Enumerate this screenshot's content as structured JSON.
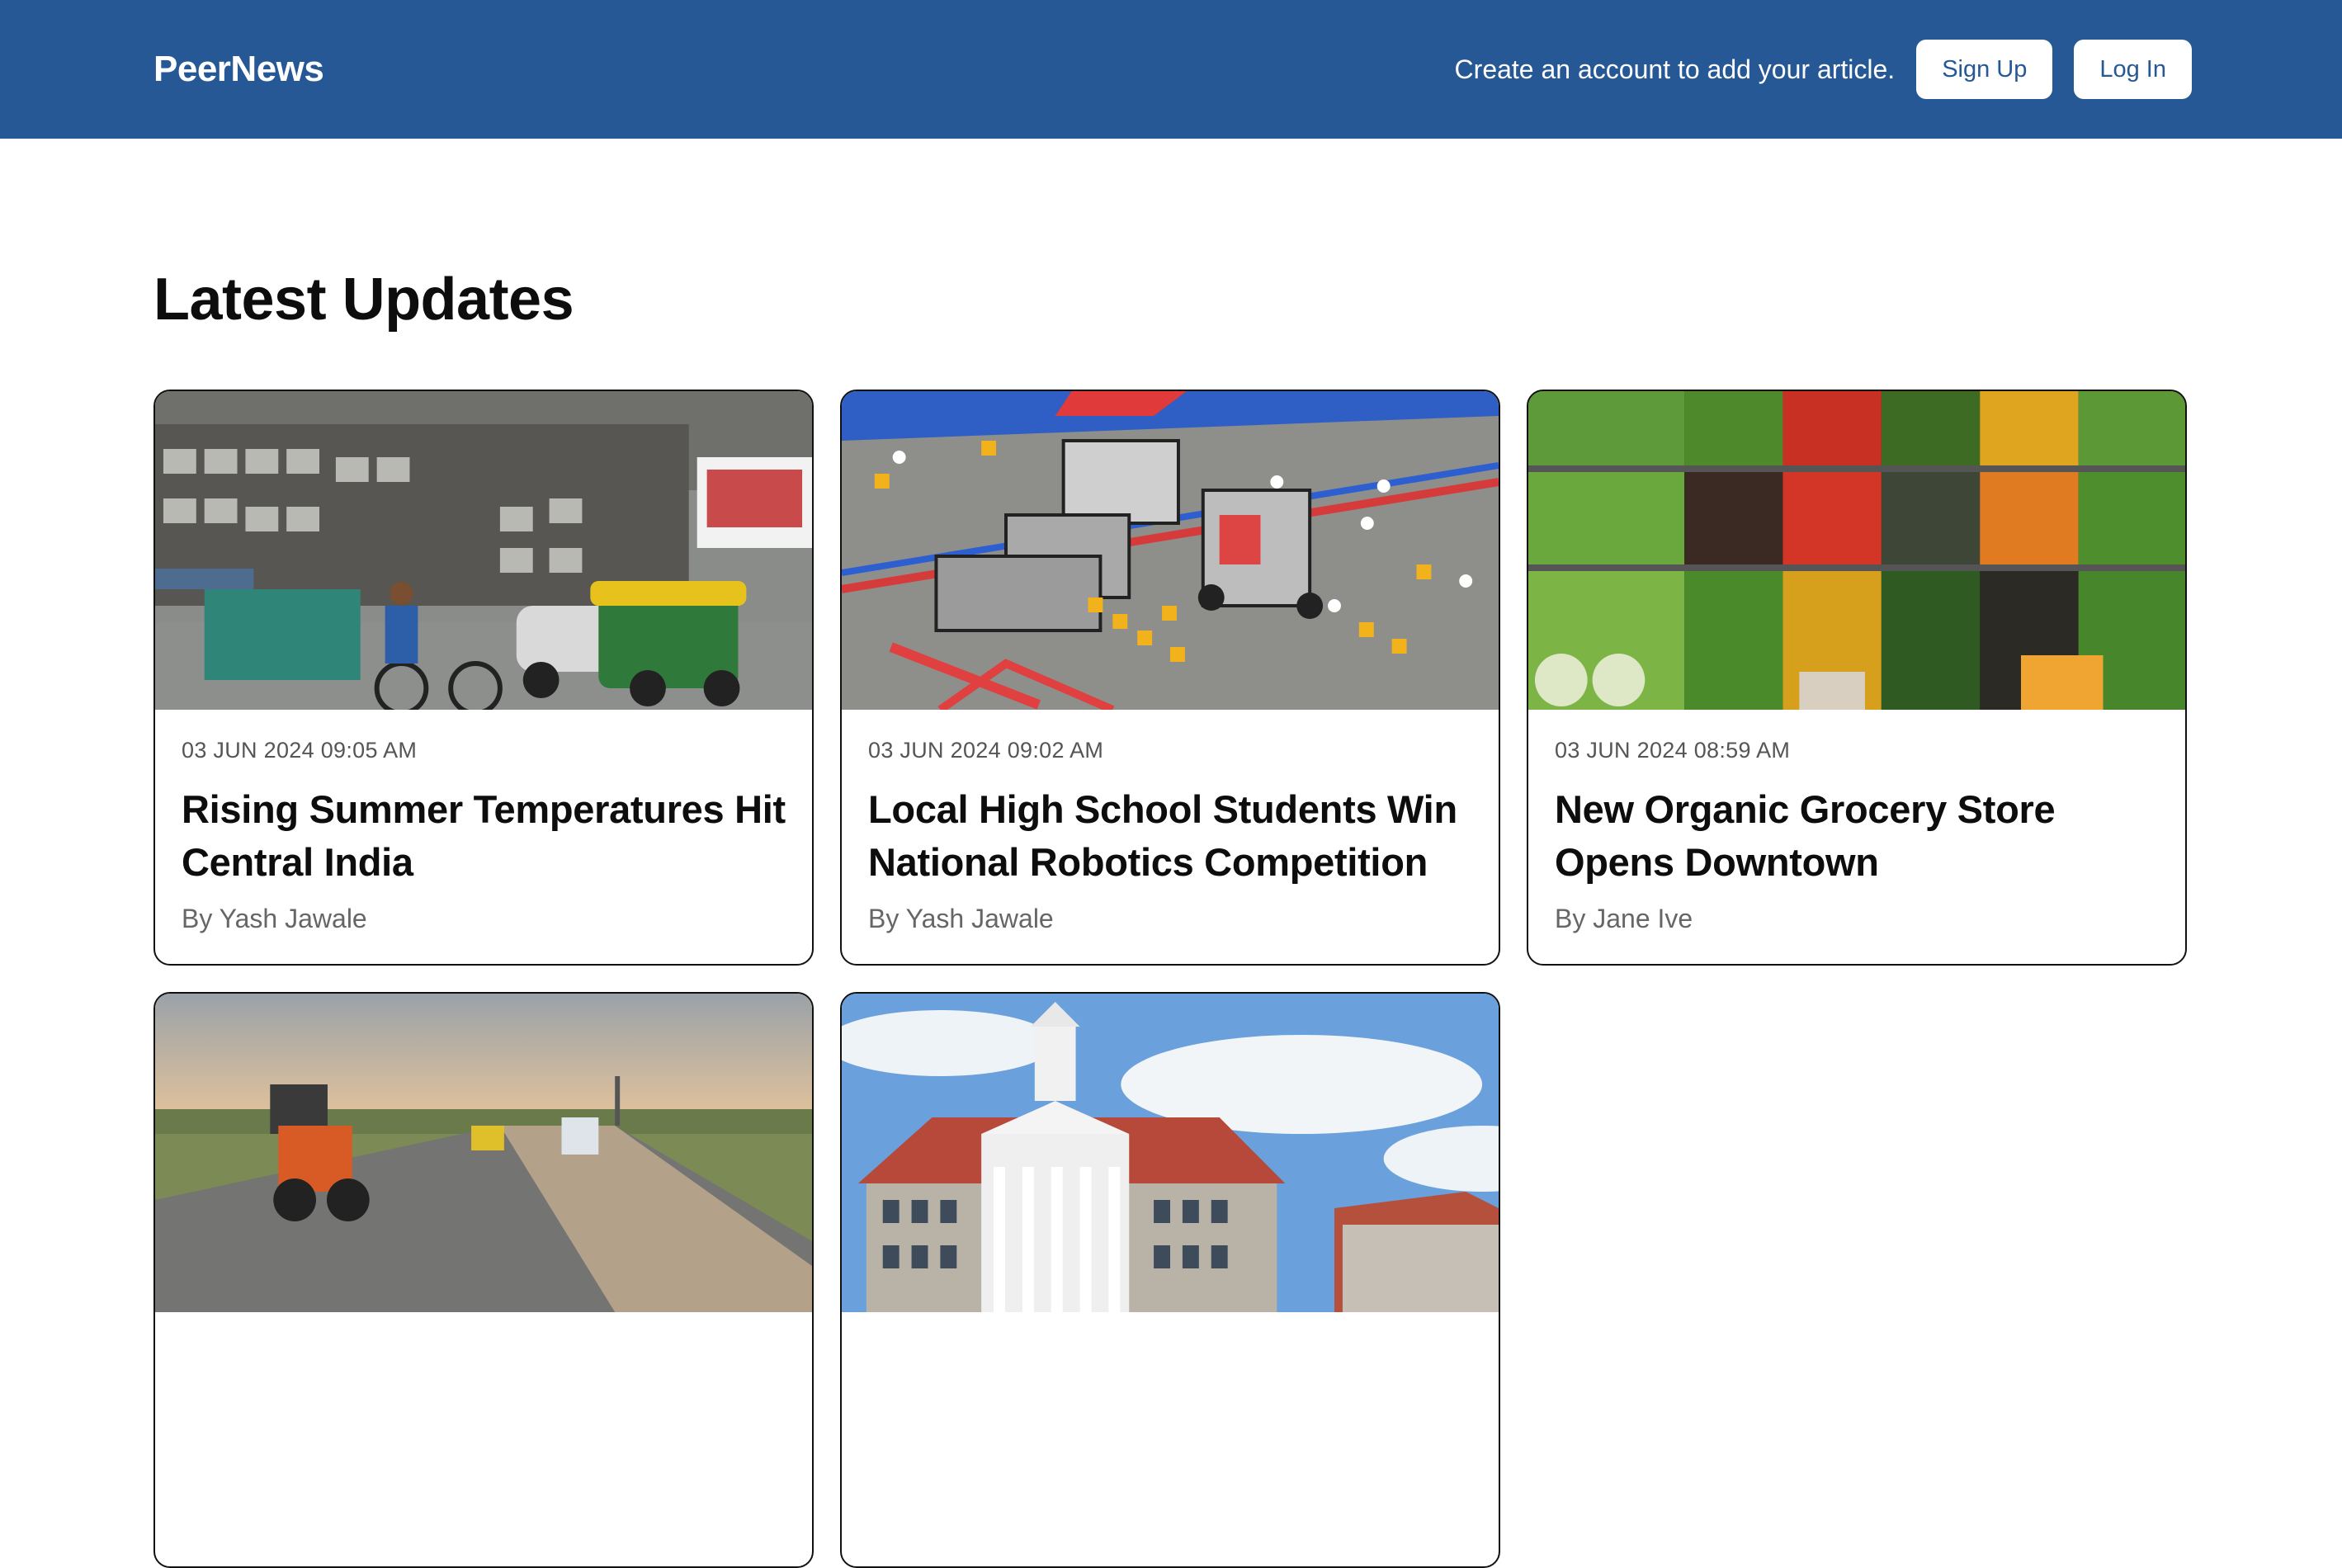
{
  "header": {
    "brand": "PeerNews",
    "prompt": "Create an account to add your article.",
    "signup_label": "Sign Up",
    "login_label": "Log In",
    "color": "#255895"
  },
  "main": {
    "title": "Latest Updates",
    "articles": [
      {
        "date": "03 JUN 2024 09:05 AM",
        "title": "Rising Summer Temperatures Hit Central India",
        "author": "By Yash Jawale",
        "image": "street-scene-photo"
      },
      {
        "date": "03 JUN 2024 09:02 AM",
        "title": "Local High School Students Win National Robotics Competition",
        "author": "By Yash Jawale",
        "image": "robotics-arena-photo"
      },
      {
        "date": "03 JUN 2024 08:59 AM",
        "title": "New Organic Grocery Store Opens Downtown",
        "author": "By Jane Ive",
        "image": "vegetable-shelves-photo"
      },
      {
        "image": "road-construction-photo"
      },
      {
        "image": "college-building-photo"
      }
    ]
  }
}
